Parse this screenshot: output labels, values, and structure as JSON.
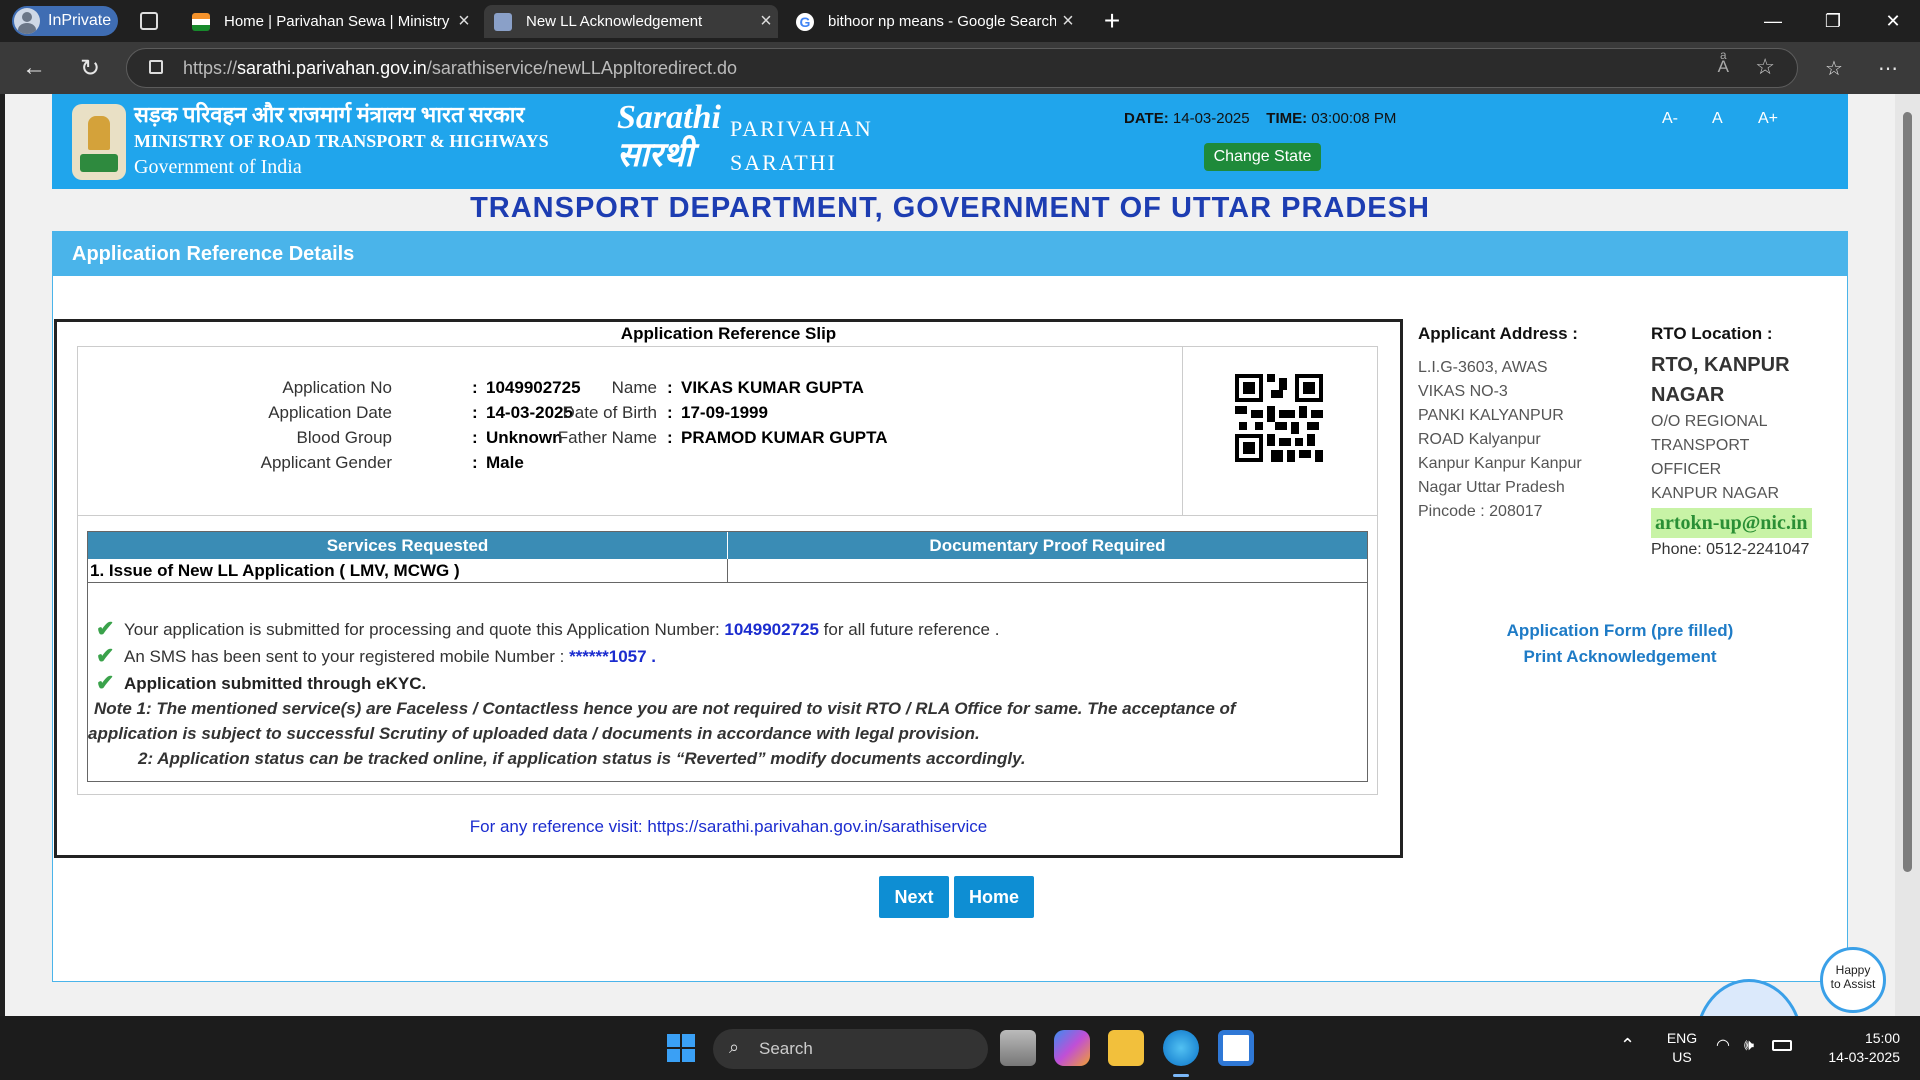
{
  "browser": {
    "profile_label": "InPrivate",
    "tabs": [
      {
        "label": "Home | Parivahan Sewa | Ministry",
        "active": false,
        "icon": "india-flag-icon"
      },
      {
        "label": "New LL Acknowledgement",
        "active": true,
        "icon": "page-icon"
      },
      {
        "label": "bithoor np means - Google Search",
        "active": false,
        "icon": "google-icon"
      }
    ],
    "url_prefix": "https://",
    "url_host": "sarathi.parivahan.gov.in",
    "url_path": "/sarathiservice/newLLAppltoredirect.do"
  },
  "header": {
    "ministry_line1": "सड़क परिवहन और राजमार्ग मंत्रालय भारत सरकार",
    "ministry_line2": "MINISTRY OF ROAD TRANSPORT & HIGHWAYS",
    "ministry_line3": "Government of India",
    "logo_text": "Sarathi सारथी",
    "brand_line1": "PARIVAHAN",
    "brand_line2": "SARATHI",
    "date_label": "DATE:",
    "date_value": "14-03-2025",
    "time_label": "TIME:",
    "time_value": "03:00:08 PM",
    "change_state": "Change State",
    "font_small": "A-",
    "font_normal": "A",
    "font_large": "A+"
  },
  "department_title": "TRANSPORT DEPARTMENT, GOVERNMENT OF UTTAR PRADESH",
  "card_title": "Application Reference Details",
  "slip": {
    "title": "Application Reference Slip",
    "labels": {
      "app_no": "Application No",
      "app_date": "Application Date",
      "blood": "Blood Group",
      "gender": "Applicant Gender",
      "name": "Name",
      "dob": "Date of Birth",
      "father": "Father Name"
    },
    "values": {
      "app_no": "1049902725",
      "app_date": "14-03-2025",
      "blood": "Unknown",
      "gender": "Male",
      "name": "VIKAS KUMAR GUPTA",
      "dob": "17-09-1999",
      "father": "PRAMOD KUMAR GUPTA"
    },
    "colon": ":",
    "services_header": "Services Requested",
    "proof_header": "Documentary Proof Required",
    "service_item": "1. Issue of New LL Application ( LMV, MCWG )",
    "msg1_pre": "Your application is submitted for processing and quote this Application Number: ",
    "msg1_num": "1049902725",
    "msg1_post": " for all future reference .",
    "msg2_pre": "An SMS has been sent to your registered mobile Number : ",
    "msg2_num": "******1057 .",
    "msg3": "Application submitted through eKYC.",
    "note1a": "Note 1:  The mentioned service(s) are Faceless / Contactless hence you are not required to visit RTO / RLA Office for same. The acceptance of",
    "note1b": "application is subject to successful Scrutiny of uploaded data / documents in accordance with legal provision.",
    "note2": "2:  Application status can be tracked online, if application status is “Reverted” modify documents accordingly.",
    "reference": "For any reference visit: https://sarathi.parivahan.gov.in/sarathiservice"
  },
  "address": {
    "heading": "Applicant Address :",
    "lines": [
      "L.I.G-3603, AWAS",
      "VIKAS NO-3",
      "PANKI KALYANPUR",
      "ROAD Kalyanpur",
      "Kanpur Kanpur Kanpur",
      "Nagar Uttar Pradesh",
      "Pincode : 208017"
    ]
  },
  "rto": {
    "heading": "RTO Location :",
    "name_lines": [
      "RTO, KANPUR",
      "NAGAR"
    ],
    "office_lines": [
      "O/O REGIONAL",
      "TRANSPORT",
      "OFFICER",
      "KANPUR NAGAR"
    ],
    "email": "artokn-up@nic.in",
    "phone": "Phone:  0512-2241047"
  },
  "links": {
    "form": "Application Form (pre filled)",
    "ack": "Print Acknowledgement"
  },
  "buttons": {
    "next": "Next",
    "home": "Home"
  },
  "assistant": {
    "bubble": "Happy to Assist"
  },
  "taskbar": {
    "search": "Search",
    "lang1": "ENG",
    "lang2": "US",
    "time": "15:00",
    "date": "14-03-2025"
  },
  "colors": {
    "header_blue": "#20a5ec",
    "card_blue": "#4ab4ea",
    "button_blue": "#0e8ed3",
    "title_blue": "#1d3db2"
  }
}
